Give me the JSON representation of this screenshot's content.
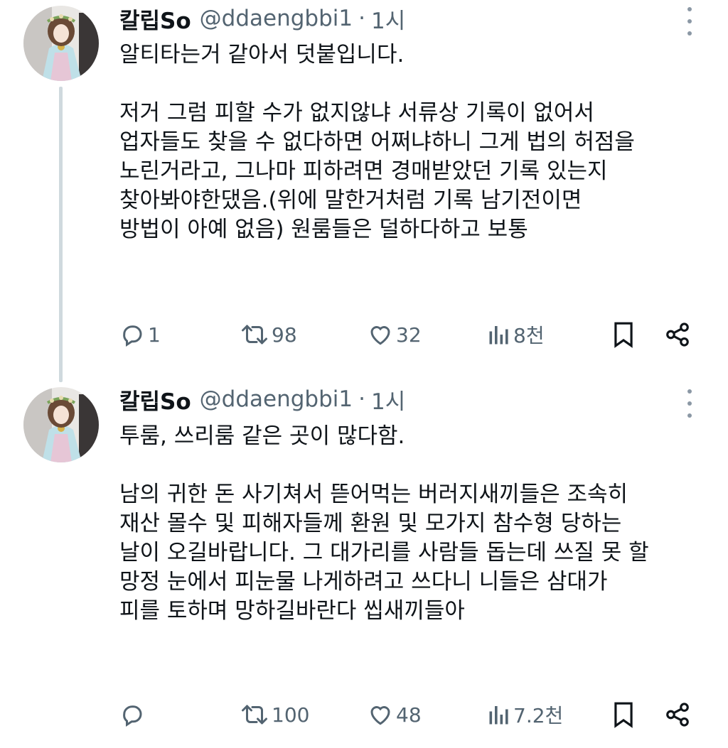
{
  "tweets": [
    {
      "name": "칼립So",
      "handle": "@ddaengbbi1",
      "separator": "·",
      "time": "1시",
      "text": "알티타는거 같아서 덧붙입니다.\n\n저거 그럼 피할 수가 없지않냐 서류상 기록이 없어서\n업자들도 찾을 수 없다하면 어쩌냐하니 그게 법의 허점을\n노린거라고, 그나마 피하려면 경매받았던 기록 있는지\n찾아봐야한댔음.(위에 말한거처럼 기록 남기전이면\n방법이 아예 없음) 원룸들은 덜하다하고 보통",
      "replies": "1",
      "retweets": "98",
      "likes": "32",
      "views": "8천"
    },
    {
      "name": "칼립So",
      "handle": "@ddaengbbi1",
      "separator": "·",
      "time": "1시",
      "text": "투룸, 쓰리룸 같은 곳이 많다함.\n\n남의 귀한 돈 사기쳐서 뜯어먹는 버러지새끼들은 조속히\n재산 몰수 및 피해자들께 환원 및 모가지 참수형 당하는\n날이 오길바랍니다. 그 대가리를 사람들 돕는데 쓰질 못 할\n망정 눈에서 피눈물 나게하려고 쓰다니 니들은 삼대가\n피를 토하며 망하길바란다 씹새끼들아",
      "replies": "",
      "retweets": "100",
      "likes": "48",
      "views": "7.2천"
    }
  ],
  "icons": {
    "reply": "reply-icon",
    "retweet": "retweet-icon",
    "like": "heart-icon",
    "views": "views-bar-chart-icon",
    "bookmark": "bookmark-icon",
    "share": "share-icon",
    "more": "more-vertical-icon"
  },
  "colors": {
    "text": "#0f1419",
    "secondary": "#536471",
    "thread_line": "#cfd9de"
  }
}
